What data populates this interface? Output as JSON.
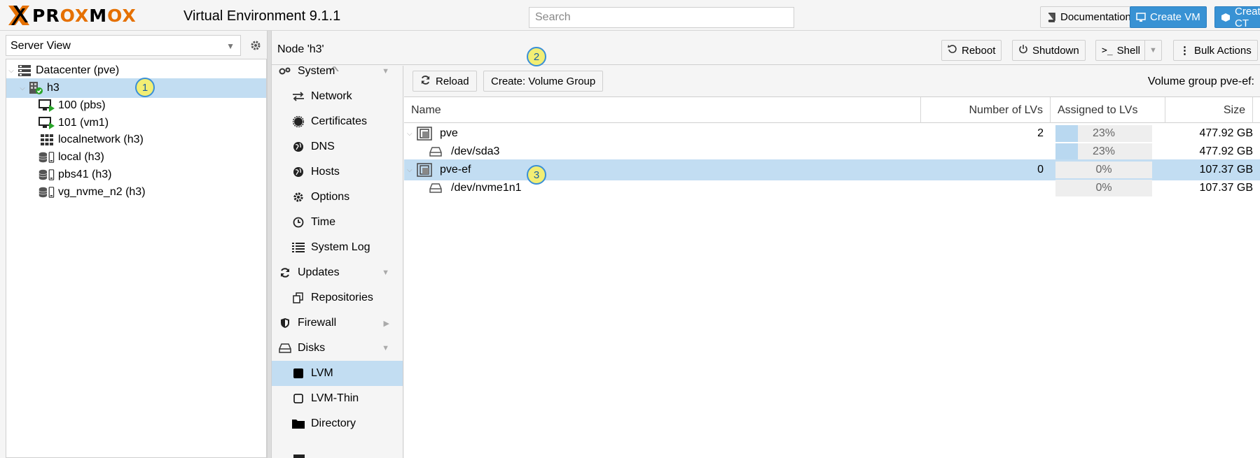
{
  "topbar": {
    "logo_text_pre": "PR",
    "logo_text_ox": "OX",
    "logo_text_mo": "M",
    "logo_text_ox2": "OX",
    "version": "Virtual Environment 9.1.1",
    "search_placeholder": "Search",
    "buttons": {
      "documentation": "Documentation",
      "create_vm": "Create VM",
      "create_ct": "Create CT"
    },
    "brand_color": "#e57000",
    "accent_color": "#3892d4"
  },
  "left": {
    "view_select": "Server View",
    "tree": [
      {
        "label": "Datacenter (pve)",
        "icon": "datacenter-icon"
      },
      {
        "label": "h3",
        "icon": "node-online-icon",
        "selected": true
      },
      {
        "label": "100 (pbs)",
        "icon": "vm-running-icon"
      },
      {
        "label": "101 (vm1)",
        "icon": "vm-running-icon"
      },
      {
        "label": "localnetwork (h3)",
        "icon": "network-grid-icon"
      },
      {
        "label": "local (h3)",
        "icon": "storage-icon"
      },
      {
        "label": "pbs41 (h3)",
        "icon": "storage-icon"
      },
      {
        "label": "vg_nvme_n2 (h3)",
        "icon": "storage-icon"
      }
    ]
  },
  "node": {
    "title": "Node 'h3'",
    "buttons": {
      "reboot": "Reboot",
      "shutdown": "Shutdown",
      "shell": "Shell",
      "bulk": "Bulk Actions"
    }
  },
  "nav": {
    "items": [
      {
        "label": "System",
        "icon": "system-icon",
        "level": "top",
        "arrow": "down"
      },
      {
        "label": "Network",
        "icon": "network-icon",
        "level": "sub"
      },
      {
        "label": "Certificates",
        "icon": "certificate-icon",
        "level": "sub"
      },
      {
        "label": "DNS",
        "icon": "globe-icon",
        "level": "sub"
      },
      {
        "label": "Hosts",
        "icon": "globe-icon",
        "level": "sub"
      },
      {
        "label": "Options",
        "icon": "gear-icon",
        "level": "sub"
      },
      {
        "label": "Time",
        "icon": "clock-icon",
        "level": "sub"
      },
      {
        "label": "System Log",
        "icon": "list-icon",
        "level": "sub"
      },
      {
        "label": "Updates",
        "icon": "refresh-icon",
        "level": "top",
        "arrow": "down"
      },
      {
        "label": "Repositories",
        "icon": "copy-icon",
        "level": "sub"
      },
      {
        "label": "Firewall",
        "icon": "shield-icon",
        "level": "top",
        "arrow": "right"
      },
      {
        "label": "Disks",
        "icon": "disk-icon",
        "level": "top",
        "arrow": "down"
      },
      {
        "label": "LVM",
        "icon": "square-filled-icon",
        "level": "sub",
        "selected": true
      },
      {
        "label": "LVM-Thin",
        "icon": "square-outline-icon",
        "level": "sub"
      },
      {
        "label": "Directory",
        "icon": "folder-icon",
        "level": "sub"
      }
    ]
  },
  "lvm": {
    "toolbar": {
      "reload": "Reload",
      "create": "Create: Volume Group",
      "selected_label": "Volume group pve-ef:"
    },
    "columns": {
      "name": "Name",
      "lvs": "Number of LVs",
      "assigned": "Assigned to LVs",
      "size": "Size"
    },
    "rows": [
      {
        "name": "pve",
        "type": "vg",
        "lvs": "2",
        "assigned_pct": 23,
        "assigned_text": "23%",
        "size": "477.92 GB"
      },
      {
        "name": "/dev/sda3",
        "type": "pv",
        "lvs": "",
        "assigned_pct": 23,
        "assigned_text": "23%",
        "size": "477.92 GB"
      },
      {
        "name": "pve-ef",
        "type": "vg",
        "lvs": "0",
        "assigned_pct": 0,
        "assigned_text": "0%",
        "size": "107.37 GB",
        "selected": true
      },
      {
        "name": "/dev/nvme1n1",
        "type": "pv",
        "lvs": "",
        "assigned_pct": 0,
        "assigned_text": "0%",
        "size": "107.37 GB"
      }
    ]
  },
  "badges": [
    "1",
    "2",
    "3"
  ]
}
